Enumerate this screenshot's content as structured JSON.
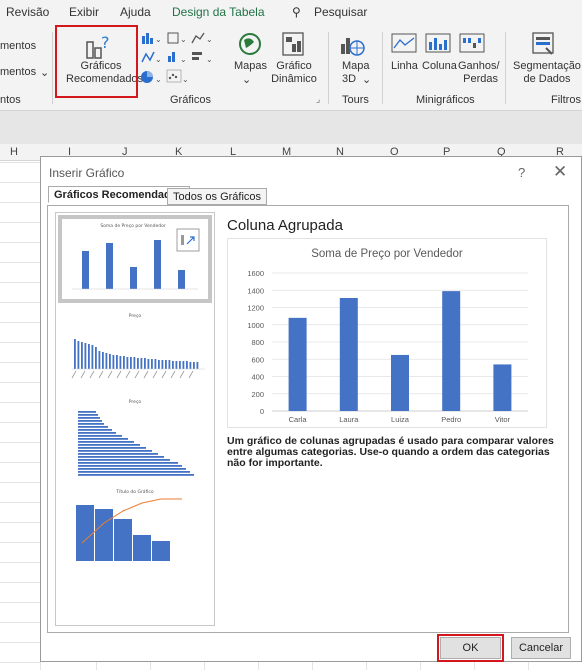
{
  "menu": [
    "Revisão",
    "Exibir",
    "Ajuda",
    "Design da Tabela",
    "Pesquisar"
  ],
  "ribbon": {
    "left_partial": [
      "mentos",
      "mentos",
      "ntos"
    ],
    "recommended_charts": "Gráficos\nRecomendados",
    "maps": "Mapas",
    "pivot_chart": "Gráfico\nDinâmico",
    "charts_group": "Gráficos",
    "map3d": "Mapa\n3D",
    "tours_group": "Tours",
    "spark_line": "Linha",
    "spark_column": "Coluna",
    "spark_winloss": "Ganhos/\nPerdas",
    "sparklines_group": "Minigráficos",
    "slicer": "Segmentação\nde Dados",
    "filters_group": "Filtros"
  },
  "columns": [
    "H",
    "I",
    "J",
    "K",
    "L",
    "M",
    "N",
    "O",
    "P",
    "Q",
    "R"
  ],
  "dialog": {
    "title": "Inserir Gráfico",
    "help": "?",
    "close": "✕",
    "tab_recommended": "Gráficos Recomendados",
    "tab_all": "Todos os Gráficos",
    "preview_title": "Coluna Agrupada",
    "description": "Um gráfico de colunas agrupadas é usado para comparar valores entre algumas categorias. Use-o quando a ordem das categorias não for importante.",
    "ok": "OK",
    "cancel": "Cancelar"
  },
  "thumbnails": {
    "t1_title": "Soma de Preço por Vendedor",
    "t2_title": "Preço",
    "t3_title": "Preço",
    "t4_title": "Título do Gráfico"
  },
  "chart_data": {
    "type": "bar",
    "title": "Soma de Preço por Vendedor",
    "categories": [
      "Carla",
      "Laura",
      "Luiza",
      "Pedro",
      "Vitor"
    ],
    "values": [
      1080,
      1310,
      650,
      1390,
      540
    ],
    "ylim": [
      0,
      1600
    ],
    "yticks": [
      0,
      200,
      400,
      600,
      800,
      1000,
      1200,
      1400,
      1600
    ],
    "grid": true,
    "color": "#4472c4"
  }
}
